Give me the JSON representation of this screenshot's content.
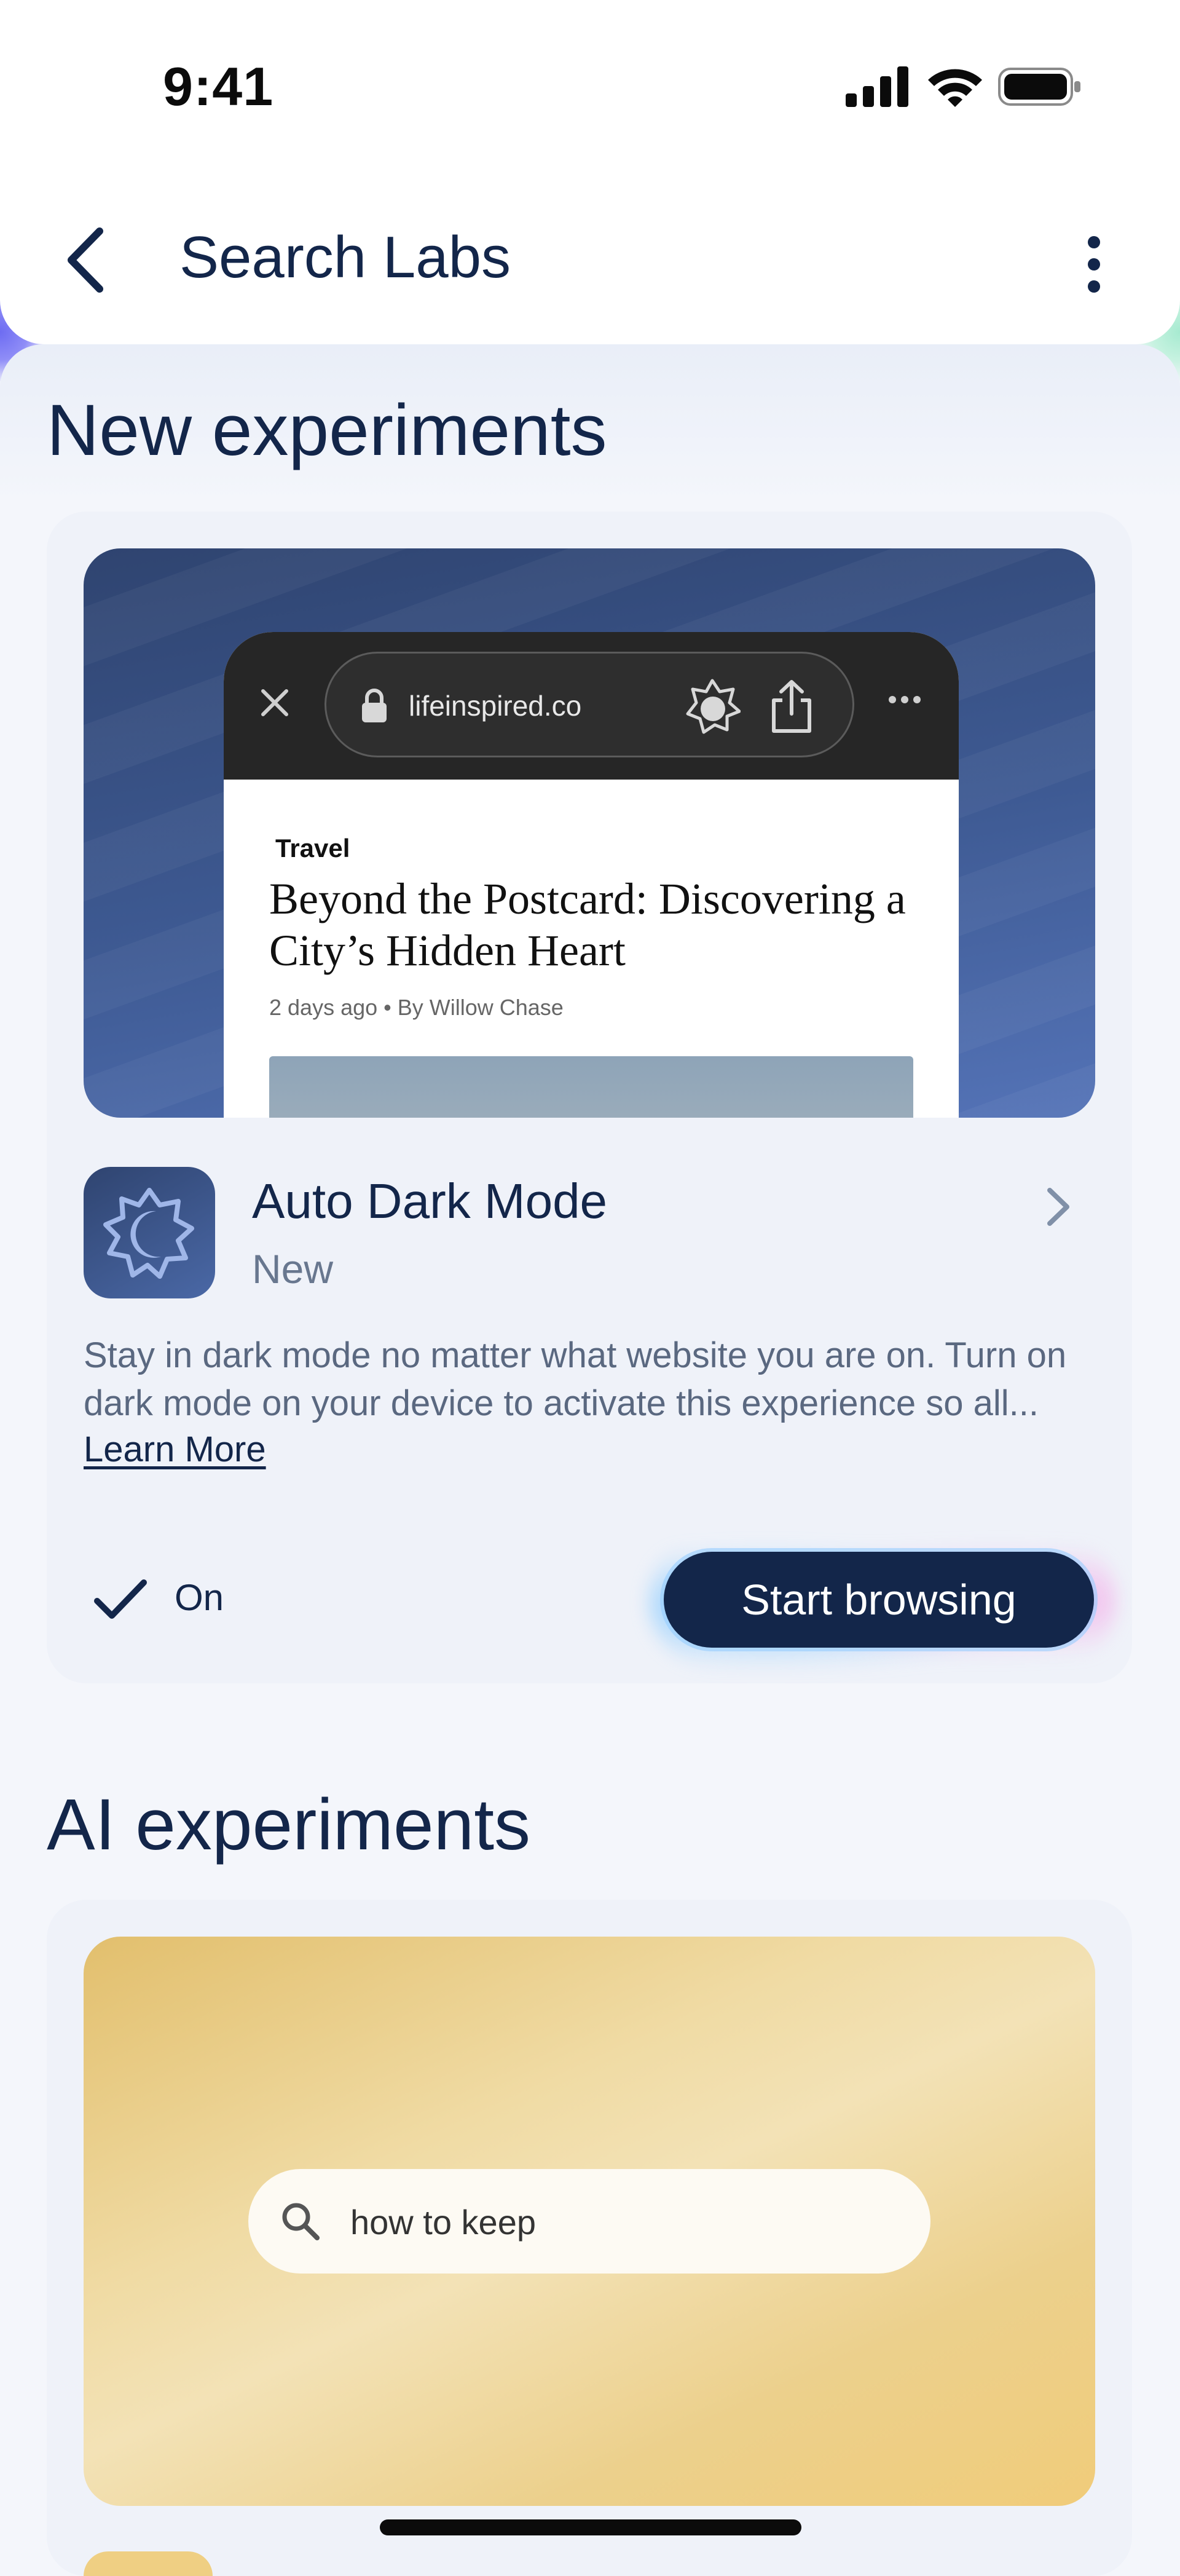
{
  "status_bar": {
    "time": "9:41"
  },
  "header": {
    "title": "Search Labs"
  },
  "sections": {
    "new_title": "New experiments",
    "ai_title": "AI experiments"
  },
  "preview": {
    "url": "lifeinspired.co",
    "category": "Travel",
    "article_title": "Beyond the Postcard: Discovering a City’s Hidden Heart",
    "meta": "2 days ago • By Willow Chase"
  },
  "experiment": {
    "name": "Auto Dark Mode",
    "badge": "New",
    "description": "Stay in dark mode no matter what website you are on. Turn on dark mode on your device to activate this experience so all...",
    "learn_more": "Learn More",
    "status": "On",
    "cta": "Start browsing"
  },
  "ai_preview": {
    "search_text": "how to keep"
  },
  "colors": {
    "primary": "#13264a",
    "card_bg": "#eff2f9",
    "page_bg": "#f4f6fb"
  }
}
